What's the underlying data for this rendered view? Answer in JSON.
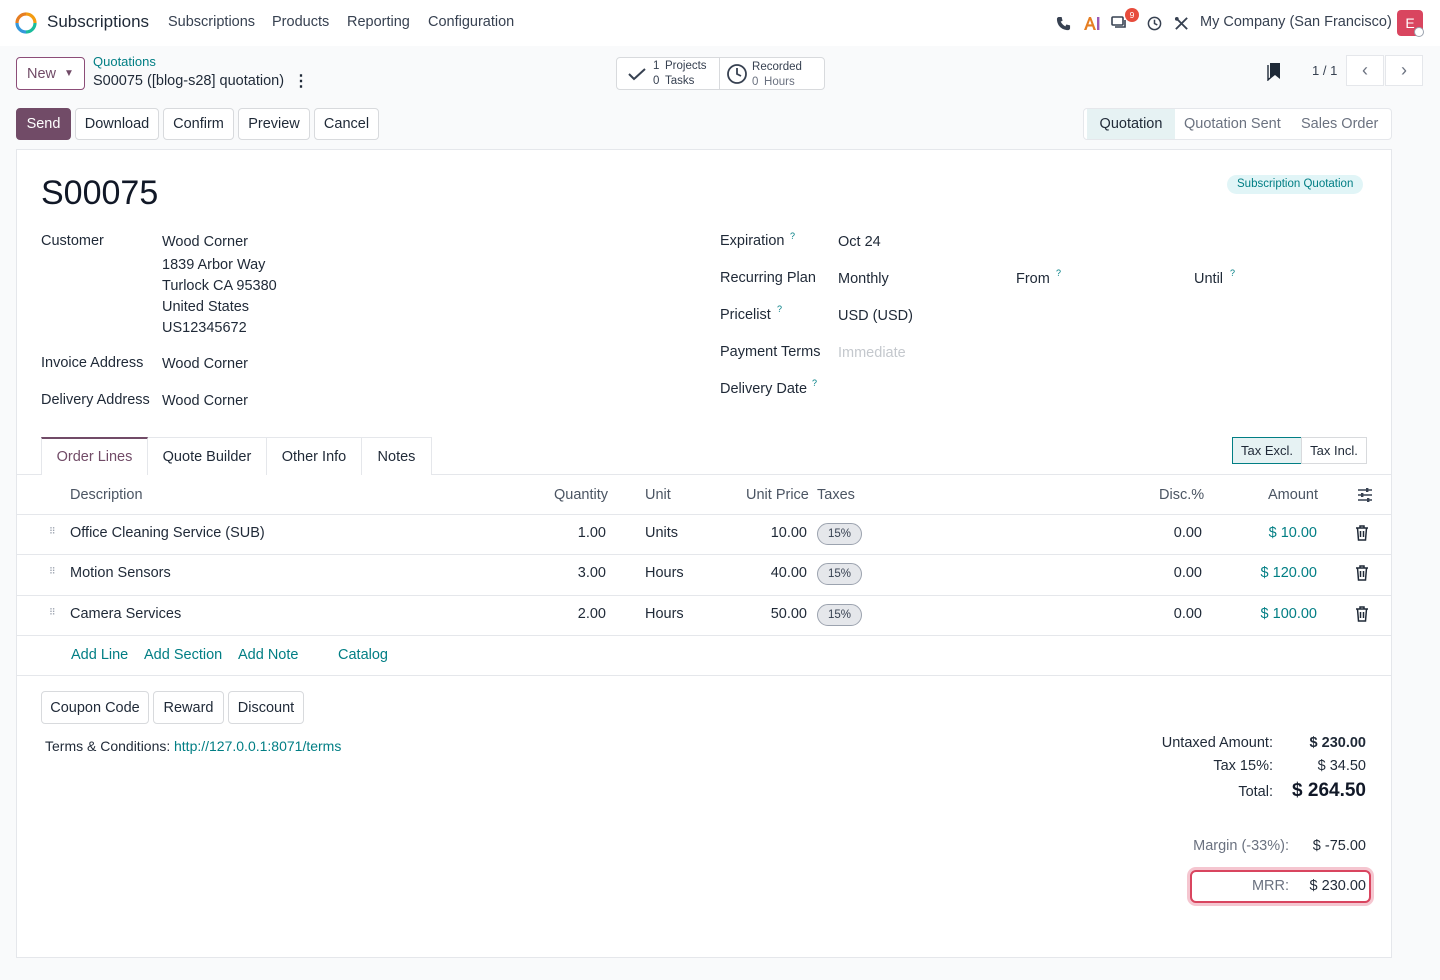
{
  "topnav": {
    "app_name": "Subscriptions",
    "menu": [
      "Subscriptions",
      "Products",
      "Reporting",
      "Configuration"
    ],
    "message_count": "9",
    "company": "My Company (San Francisco)",
    "avatar_letter": "E"
  },
  "control": {
    "new_label": "New",
    "breadcrumb_parent": "Quotations",
    "breadcrumb_current": "S00075 ([blog-s28] quotation)",
    "smart_projects_count": "1",
    "smart_projects_label": "Projects",
    "smart_tasks_count": "0",
    "smart_tasks_label": "Tasks",
    "smart_recorded_label": "Recorded",
    "smart_hours_count": "0",
    "smart_hours_label": "Hours",
    "pager": "1 / 1"
  },
  "actions": {
    "send": "Send",
    "download": "Download",
    "confirm": "Confirm",
    "preview": "Preview",
    "cancel": "Cancel"
  },
  "status": {
    "stages": [
      "Quotation",
      "Quotation Sent",
      "Sales Order"
    ],
    "active": "Quotation"
  },
  "record": {
    "name": "S00075",
    "tag": "Subscription Quotation",
    "customer_label": "Customer",
    "customer_lines": [
      "Wood Corner",
      "1839 Arbor Way",
      "Turlock CA 95380",
      "United States",
      "US12345672"
    ],
    "invoice_label": "Invoice Address",
    "invoice_value": "Wood Corner",
    "delivery_label": "Delivery Address",
    "delivery_value": "Wood Corner",
    "expiration_label": "Expiration",
    "expiration_value": "Oct 24",
    "plan_label": "Recurring Plan",
    "plan_value": "Monthly",
    "from_label": "From",
    "until_label": "Until",
    "pricelist_label": "Pricelist",
    "pricelist_value": "USD (USD)",
    "terms_label": "Payment Terms",
    "terms_placeholder": "Immediate",
    "delivery_date_label": "Delivery Date",
    "help_mark": "?"
  },
  "tabs": [
    "Order Lines",
    "Quote Builder",
    "Other Info",
    "Notes"
  ],
  "tax_toggle": [
    "Tax Excl.",
    "Tax Incl."
  ],
  "table": {
    "headers": {
      "description": "Description",
      "quantity": "Quantity",
      "unit": "Unit",
      "unit_price": "Unit Price",
      "taxes": "Taxes",
      "disc": "Disc.%",
      "amount": "Amount"
    },
    "rows": [
      {
        "description": "Office Cleaning Service (SUB)",
        "quantity": "1.00",
        "unit": "Units",
        "unit_price": "10.00",
        "tax": "15%",
        "disc": "0.00",
        "amount": "$ 10.00"
      },
      {
        "description": "Motion Sensors",
        "quantity": "3.00",
        "unit": "Hours",
        "unit_price": "40.00",
        "tax": "15%",
        "disc": "0.00",
        "amount": "$ 120.00"
      },
      {
        "description": "Camera Services",
        "quantity": "2.00",
        "unit": "Hours",
        "unit_price": "50.00",
        "tax": "15%",
        "disc": "0.00",
        "amount": "$ 100.00"
      }
    ],
    "add_line": "Add Line",
    "add_section": "Add Section",
    "add_note": "Add Note",
    "catalog": "Catalog"
  },
  "footer": {
    "coupon": "Coupon Code",
    "reward": "Reward",
    "discount": "Discount",
    "terms_label": "Terms & Conditions:",
    "terms_link": "http://127.0.0.1:8071/terms"
  },
  "totals": {
    "untaxed_label": "Untaxed Amount:",
    "untaxed_value": "$ 230.00",
    "tax_label": "Tax 15%:",
    "tax_value": "$ 34.50",
    "total_label": "Total:",
    "total_value": "$ 264.50",
    "margin_label": "Margin (-33%):",
    "margin_value": "$ -75.00",
    "mrr_label": "MRR:",
    "mrr_value": "$ 230.00"
  },
  "colors": {
    "brand": "#714b67",
    "accent": "#017e84",
    "danger": "#d9455f"
  }
}
